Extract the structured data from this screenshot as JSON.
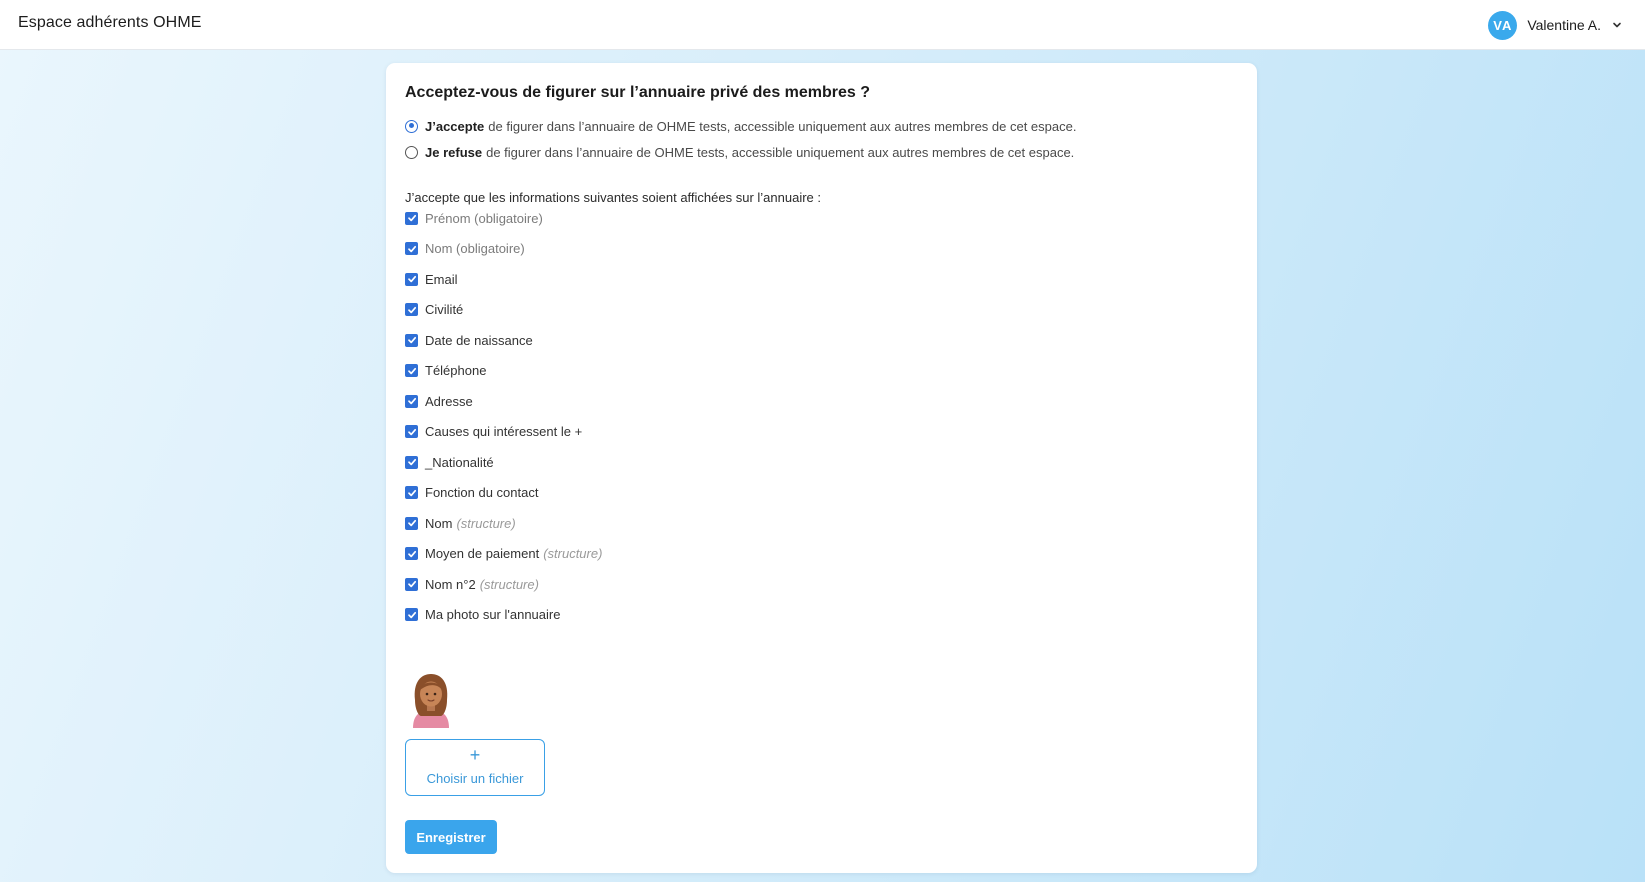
{
  "header": {
    "brand": "Espace adhérents OHME",
    "user_initials": "VA",
    "user_name": "Valentine A."
  },
  "form": {
    "title": "Acceptez-vous de figurer sur l’annuaire privé des membres ?",
    "accept": {
      "bold": "J’accepte",
      "text": "de figurer dans l’annuaire de OHME tests, accessible uniquement aux autres membres de cet espace.",
      "selected": true
    },
    "refuse": {
      "bold": "Je refuse",
      "text": "de figurer dans l’annuaire de OHME tests, accessible uniquement aux autres membres de cet espace.",
      "selected": false
    },
    "intro": "J’accepte que les informations suivantes soient affichées sur l’annuaire :",
    "fields": [
      {
        "label": "Prénom (obligatoire)",
        "hint": "",
        "checked": true,
        "disabled": true
      },
      {
        "label": "Nom (obligatoire)",
        "hint": "",
        "checked": true,
        "disabled": true
      },
      {
        "label": "Email",
        "hint": "",
        "checked": true
      },
      {
        "label": "Civilité",
        "hint": "",
        "checked": true
      },
      {
        "label": "Date de naissance",
        "hint": "",
        "checked": true
      },
      {
        "label": "Téléphone",
        "hint": "",
        "checked": true
      },
      {
        "label": "Adresse",
        "hint": "",
        "checked": true
      },
      {
        "label": "Causes qui intéressent le +",
        "hint": "",
        "checked": true
      },
      {
        "label": "_Nationalité",
        "hint": "",
        "checked": true
      },
      {
        "label": "Fonction du contact",
        "hint": "",
        "checked": true
      },
      {
        "label": "Nom",
        "hint": "(structure)",
        "checked": true
      },
      {
        "label": "Moyen de paiement",
        "hint": "(structure)",
        "checked": true
      },
      {
        "label": "Nom n°2",
        "hint": "(structure)",
        "checked": true
      },
      {
        "label": "Ma photo sur l'annuaire",
        "hint": "",
        "checked": true
      }
    ],
    "upload_icon": "+",
    "upload_label": "Choisir un fichier",
    "save_label": "Enregistrer"
  },
  "colors": {
    "accent": "#3aa5ec",
    "checkbox": "#2f6fd6",
    "avatar": "#3aa9ec"
  }
}
